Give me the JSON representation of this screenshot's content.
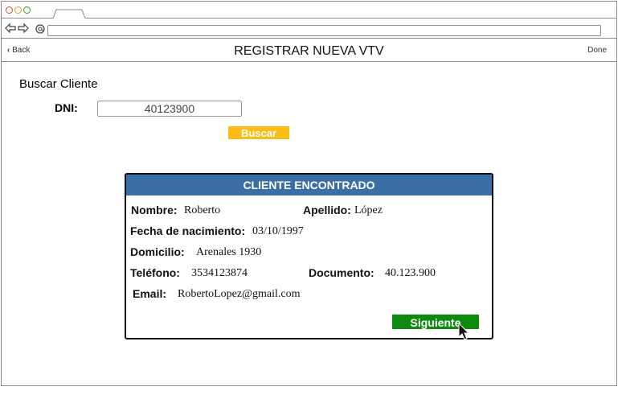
{
  "browser": {
    "url": ""
  },
  "header": {
    "back_label": "Back",
    "title": "REGISTRAR NUEVA VTV",
    "done_label": "Done"
  },
  "search": {
    "section_title": "Buscar Cliente",
    "dni_label": "DNI:",
    "dni_value": "40123900",
    "button_label": "Buscar"
  },
  "client": {
    "title": "CLIENTE ENCONTRADO",
    "nombre_label": "Nombre:",
    "nombre_value": "Roberto",
    "apellido_label": "Apellido:",
    "apellido_value": "López",
    "fecha_label": "Fecha de nacimiento:",
    "fecha_value": "03/10/1997",
    "domicilio_label": "Domicilio:",
    "domicilio_value": "Arenales 1930",
    "telefono_label": "Teléfono:",
    "telefono_value": "3534123874",
    "documento_label": "Documento:",
    "documento_value": "40.123.900",
    "email_label": "Email:",
    "email_value": "RobertoLopez@gmail.com",
    "next_label": "Siguiente"
  },
  "colors": {
    "accent_yellow": "#fbbc16",
    "card_header_blue": "#3c6ea6",
    "next_green": "#0e8a0e"
  },
  "icons": [
    "close-dot-icon",
    "minimize-dot-icon",
    "maximize-dot-icon",
    "back-arrow-icon",
    "forward-arrow-icon",
    "reload-icon",
    "chevron-left-icon",
    "mouse-cursor-icon"
  ]
}
